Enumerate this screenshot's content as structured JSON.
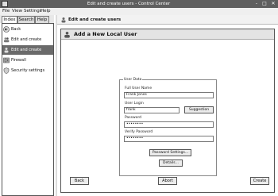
{
  "window": {
    "title": "Edit and create users - Control Center",
    "min_label": "-",
    "max_label": "□",
    "close_label": "✕"
  },
  "menubar": {
    "items": [
      {
        "label": "File"
      },
      {
        "label": "View"
      },
      {
        "label": "Settings"
      },
      {
        "label": "Help"
      }
    ]
  },
  "sidebar": {
    "tabs": [
      {
        "label": "Index"
      },
      {
        "label": "Search"
      },
      {
        "label": "Help"
      }
    ],
    "items": [
      {
        "label": "Back",
        "icon": "back-icon"
      },
      {
        "label": "Edit and create groups",
        "icon": "groups-icon"
      },
      {
        "label": "Edit and create users",
        "icon": "users-icon"
      },
      {
        "label": "Firewall",
        "icon": "firewall-icon"
      },
      {
        "label": "Security settings",
        "icon": "security-icon"
      }
    ]
  },
  "breadcrumb": {
    "label": "Edit and create users"
  },
  "panel": {
    "title": "Add a New Local User"
  },
  "form": {
    "legend": "User Data",
    "full_name_label": "Full User Name",
    "full_name_value": "Frank Jones",
    "login_label": "User Login",
    "login_value": "frank",
    "suggestion_label": "Suggestion",
    "password_label": "Password",
    "password_value": "••••••••",
    "verify_label": "Verify Password",
    "verify_value": "••••••••",
    "password_settings_label": "Password Settings...",
    "details_label": "Details..."
  },
  "buttons": {
    "back": "Back",
    "abort": "Abort",
    "create": "Create"
  }
}
